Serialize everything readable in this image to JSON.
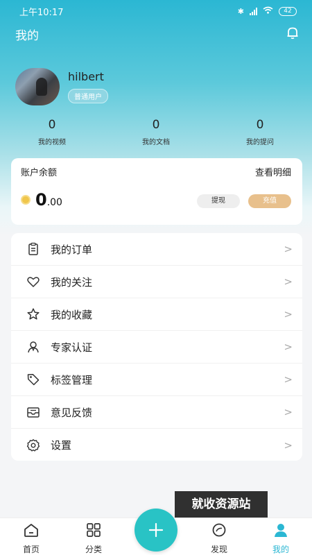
{
  "status_bar": {
    "time": "上午10:17",
    "battery": "42"
  },
  "header": {
    "title": "我的",
    "bell_icon": "bell-icon"
  },
  "profile": {
    "username": "hilbert",
    "badge": "普通用户"
  },
  "stats": [
    {
      "value": "0",
      "label": "我的视频"
    },
    {
      "value": "0",
      "label": "我的文档"
    },
    {
      "value": "0",
      "label": "我的提问"
    }
  ],
  "balance": {
    "title": "账户余额",
    "detail_link": "查看明细",
    "amount_int": "0",
    "amount_dec": ".00",
    "withdraw_label": "提现",
    "recharge_label": "充值"
  },
  "menu": [
    {
      "label": "我的订单",
      "icon": "order-icon",
      "arrow": ">"
    },
    {
      "label": "我的关注",
      "icon": "heart-icon",
      "arrow": ">"
    },
    {
      "label": "我的收藏",
      "icon": "star-icon",
      "arrow": ">"
    },
    {
      "label": "专家认证",
      "icon": "expert-icon",
      "arrow": ">"
    },
    {
      "label": "标签管理",
      "icon": "tag-icon",
      "arrow": ">"
    },
    {
      "label": "意见反馈",
      "icon": "feedback-icon",
      "arrow": ">"
    },
    {
      "label": "设置",
      "icon": "gear-icon",
      "arrow": ">"
    }
  ],
  "watermark": "就收资源站",
  "tabs": [
    {
      "label": "首页",
      "icon": "home-icon"
    },
    {
      "label": "分类",
      "icon": "category-icon"
    },
    {
      "label": "发现",
      "icon": "discover-icon"
    },
    {
      "label": "我的",
      "icon": "profile-icon"
    }
  ],
  "colors": {
    "accent": "#2bb7d3",
    "fab": "#29c3c5",
    "recharge": "#e8c08c"
  }
}
